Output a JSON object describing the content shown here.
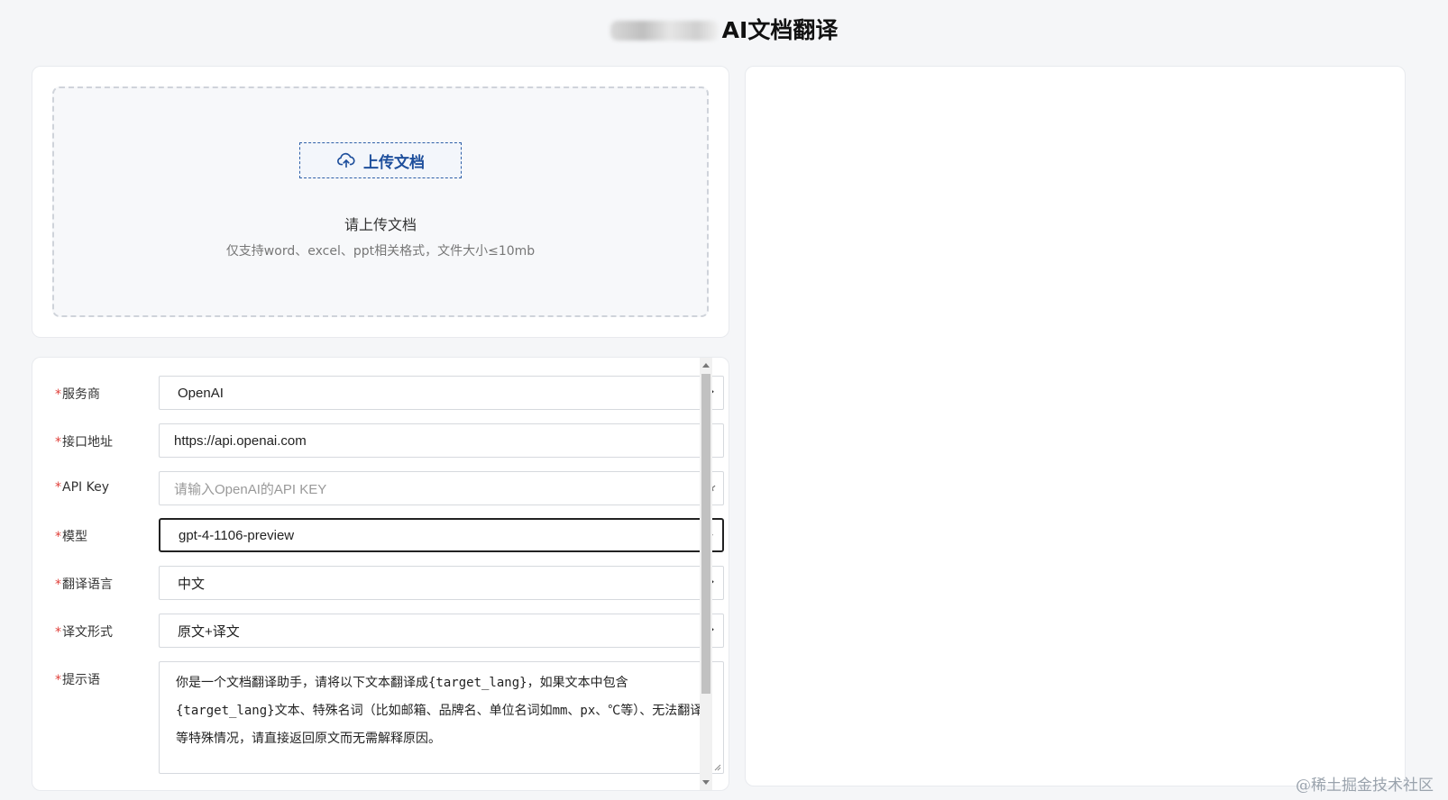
{
  "header": {
    "title": "AI文档翻译"
  },
  "upload": {
    "button_label": "上传文档",
    "hint": "请上传文档",
    "subhint": "仅支持word、excel、ppt相关格式，文件大小≤10mb"
  },
  "form": {
    "required_mark": "*",
    "provider": {
      "label": "服务商",
      "value": "OpenAI"
    },
    "endpoint": {
      "label": "接口地址",
      "value": "https://api.openai.com"
    },
    "api_key": {
      "label": "API Key",
      "placeholder": "请输入OpenAI的API KEY"
    },
    "model": {
      "label": "模型",
      "value": "gpt-4-1106-preview"
    },
    "target_language": {
      "label": "翻译语言",
      "value": "中文"
    },
    "output_format": {
      "label": "译文形式",
      "value": "原文+译文"
    },
    "prompt": {
      "label": "提示语",
      "value": "你是一个文档翻译助手，请将以下文本翻译成{target_lang}，如果文本中包含{target_lang}文本、特殊名词（比如邮箱、品牌名、单位名词如mm、px、℃等）、无法翻译等特殊情况，请直接返回原文而无需解释原因。"
    }
  },
  "watermark": "@稀土掘金技术社区",
  "colors": {
    "accent": "#1e4f9c",
    "required": "#e0403a",
    "background": "#f5f6f8"
  },
  "icons": [
    "upload-cloud-icon",
    "chevron-down-icon",
    "eye-closed-icon"
  ]
}
